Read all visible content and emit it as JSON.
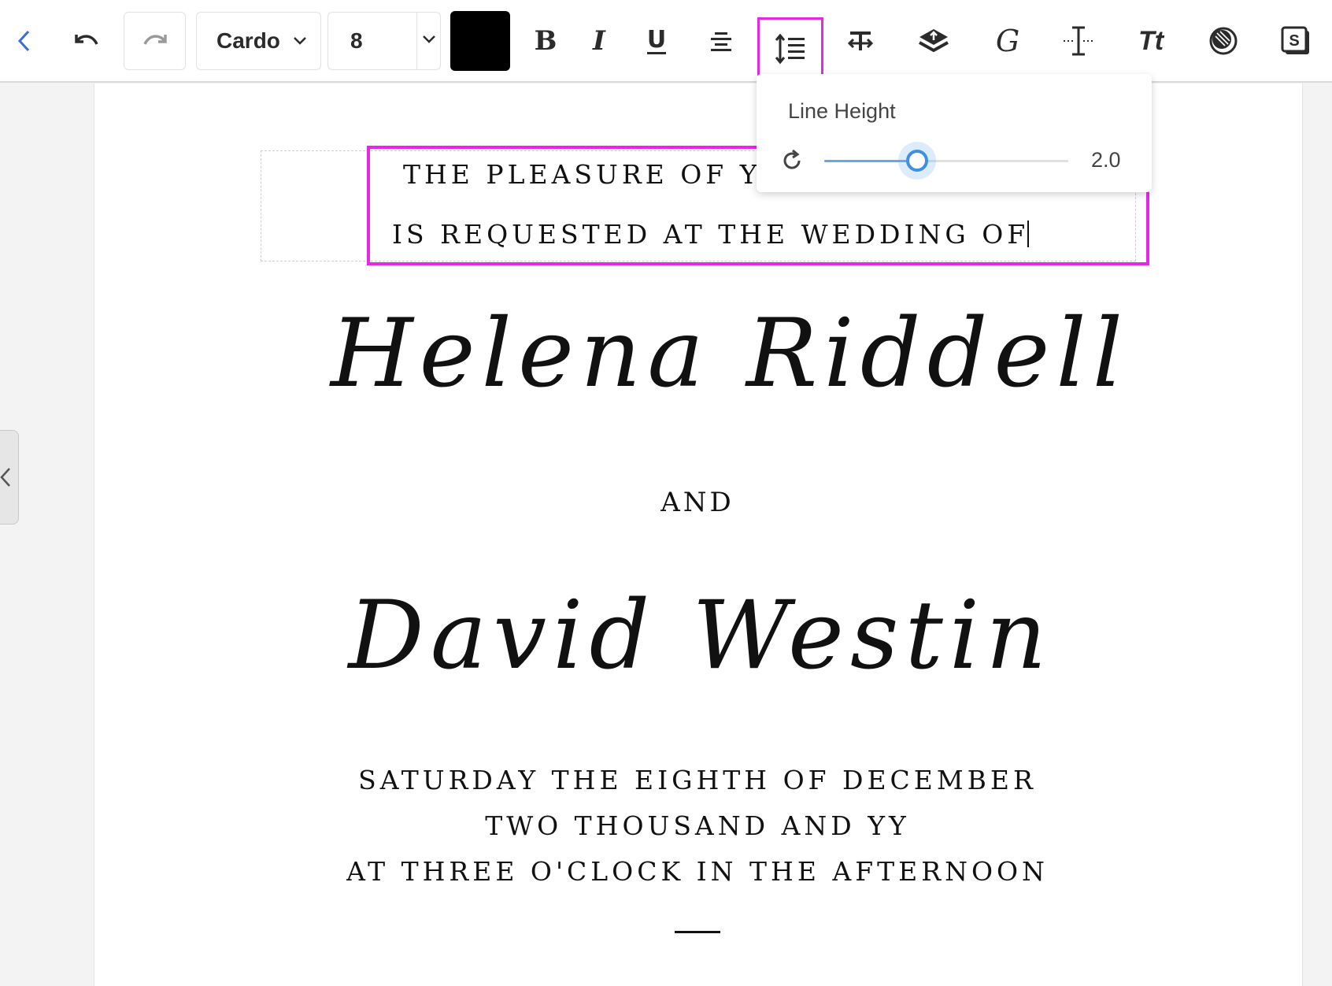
{
  "toolbar": {
    "font_name": "Cardo",
    "font_size": "8",
    "text_color": "#000000",
    "bold_label": "B",
    "italic_label": "I",
    "underline_label": "U",
    "glyph_label": "G",
    "tt_label": "Tt",
    "sticker_label": "S",
    "icons": [
      "back-arrow-icon",
      "undo-icon",
      "redo-icon",
      "chevron-down-icon",
      "align-center-icon",
      "line-height-icon",
      "letter-spacing-icon",
      "layers-icon",
      "glyph-icon",
      "text-cursor-icon",
      "text-transform-icon",
      "mask-icon",
      "sticker-icon"
    ]
  },
  "line_height_popover": {
    "title": "Line Height",
    "value_label": "2.0",
    "slider_fraction": 0.38
  },
  "canvas": {
    "line1": "THE PLEASURE OF YO",
    "line2": "IS REQUESTED AT THE WEDDING OF",
    "name1": "Helena Riddell",
    "and": "AND",
    "name2": "David Westin",
    "date_line1": "SATURDAY THE EIGHTH OF DECEMBER",
    "date_line2": "TWO THOUSAND AND YY",
    "date_line3": "AT THREE O'CLOCK IN THE AFTERNOON"
  },
  "colors": {
    "highlight": "#e727e8",
    "slider_accent": "#3f8fe2"
  }
}
